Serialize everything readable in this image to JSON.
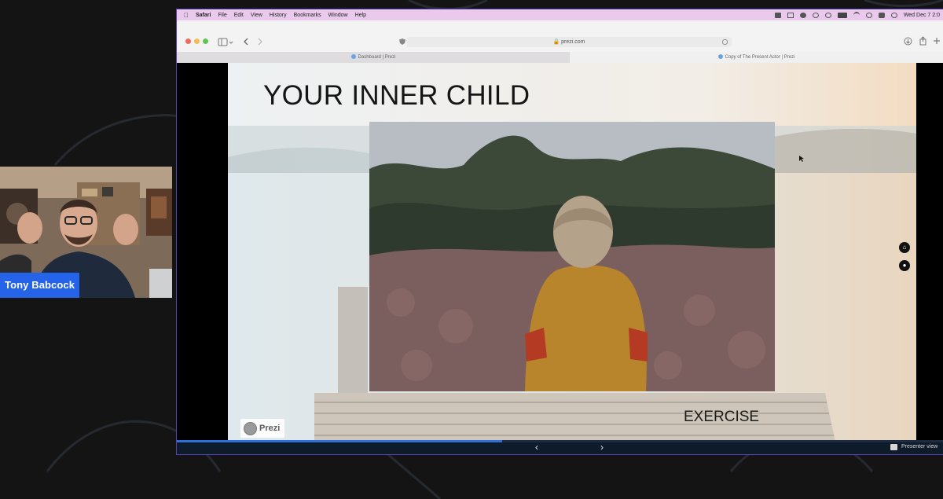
{
  "webcam": {
    "participant_name": "Tony Babcock"
  },
  "menubar": {
    "app": "Safari",
    "items": [
      "File",
      "Edit",
      "View",
      "History",
      "Bookmarks",
      "Window",
      "Help"
    ],
    "clock": "Wed Dec 7  2:0"
  },
  "browser": {
    "url": "prezi.com",
    "tabs": [
      "Dashboard | Prezi",
      "Copy of The Present Actor | Prezi"
    ]
  },
  "slide": {
    "title": "YOUR INNER CHILD",
    "subtitle": "EXERCISE",
    "brand_badge": "Prezi"
  },
  "presenter": {
    "progress": 0.425,
    "label": "Presenter view",
    "prev_icon": "chevron-left-icon",
    "next_icon": "chevron-right-icon"
  },
  "colors": {
    "accent": "#2563e8",
    "menubar": "#e9c9ec",
    "window_outline": "#5b3fb2"
  }
}
